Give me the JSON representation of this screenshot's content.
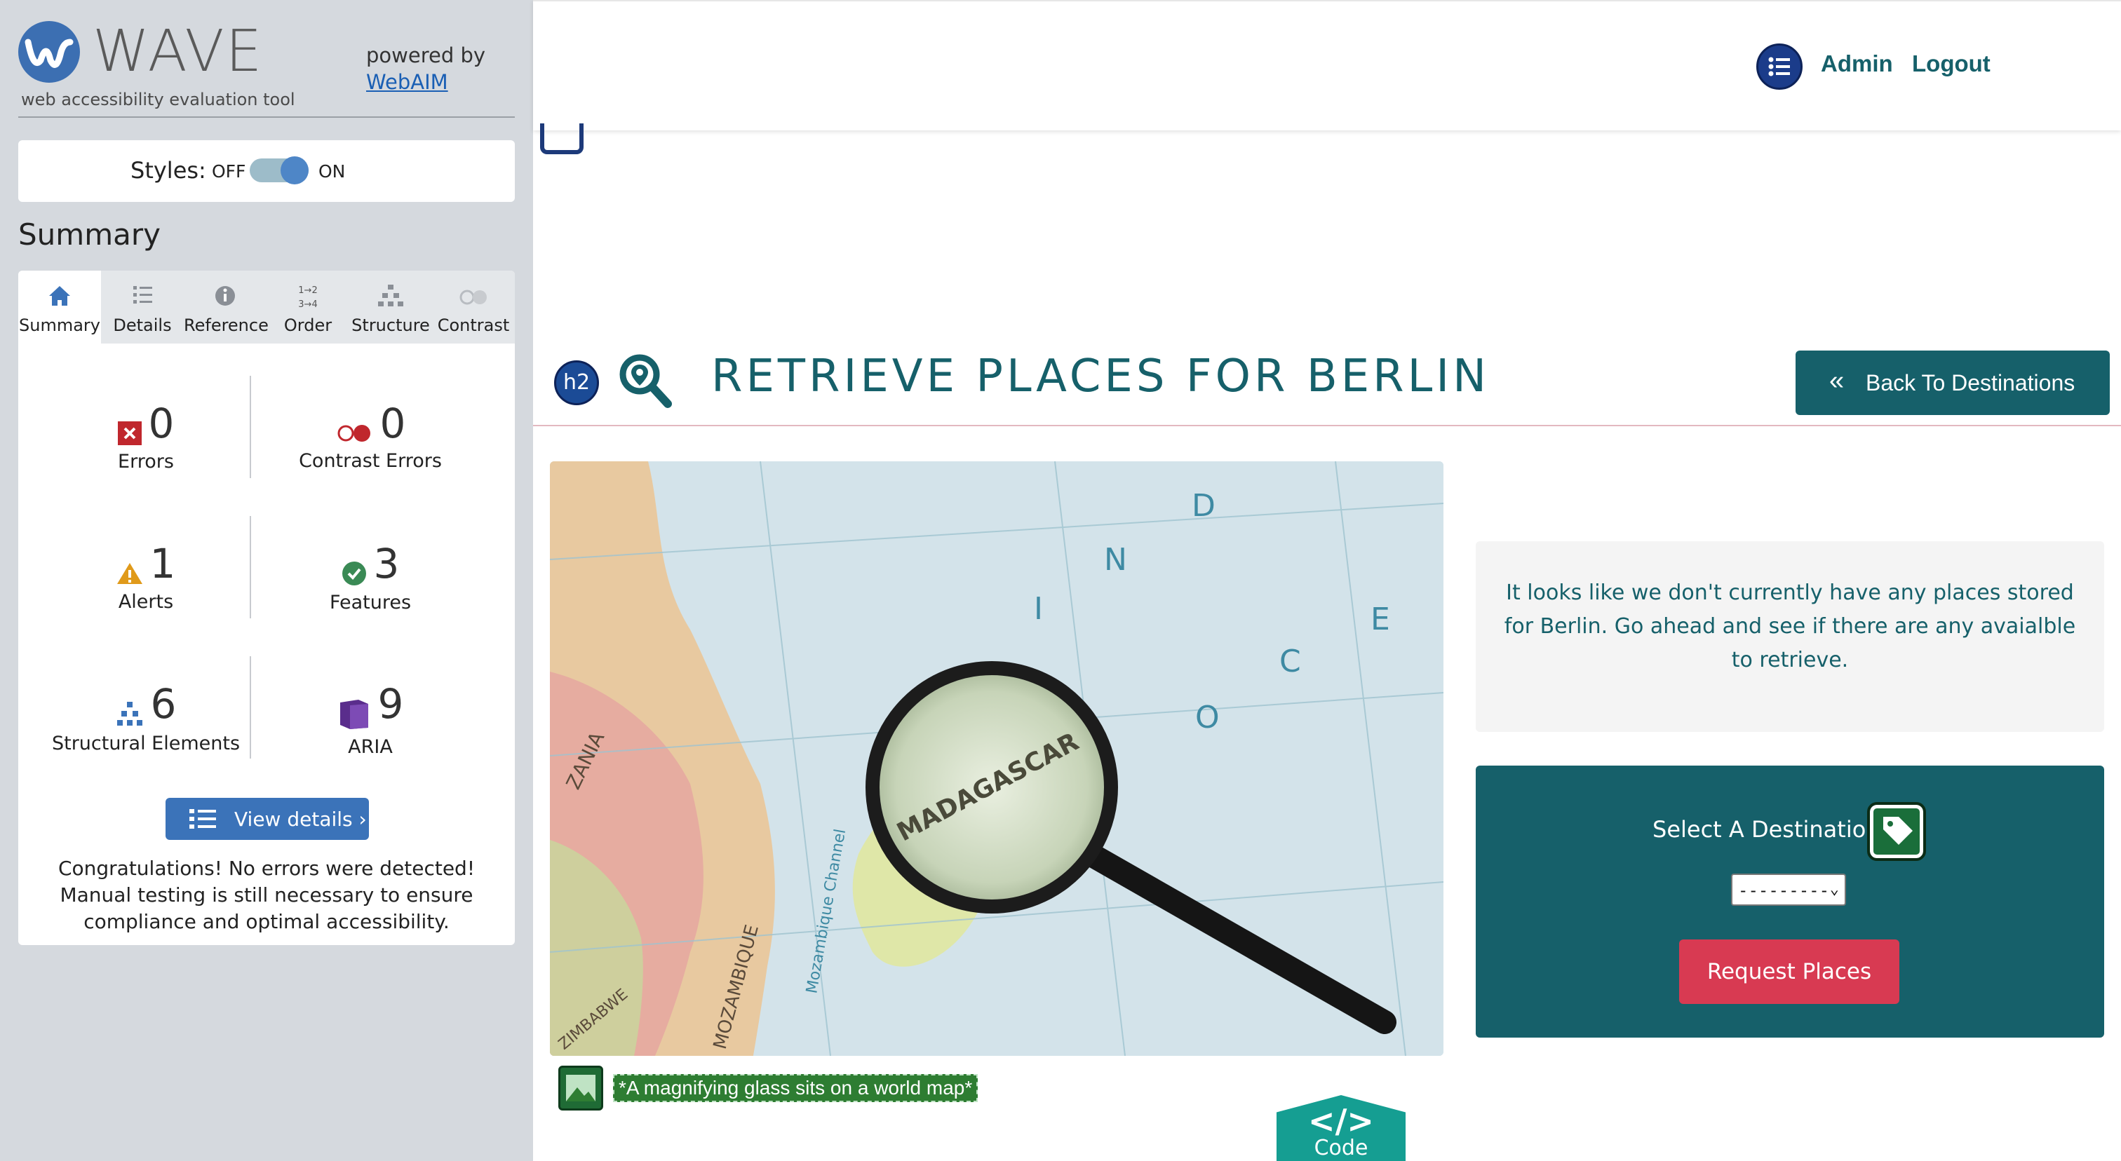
{
  "wave": {
    "title": "WAVE",
    "tagline": "web accessibility evaluation tool",
    "powered_by": "powered by",
    "webaim_link": "WebAIM",
    "styles_label": "Styles:",
    "styles_off": "OFF",
    "styles_on": "ON",
    "summary_heading": "Summary",
    "tabs": [
      {
        "label": "Summary",
        "icon": "home-icon"
      },
      {
        "label": "Details",
        "icon": "list-icon"
      },
      {
        "label": "Reference",
        "icon": "info-icon"
      },
      {
        "label": "Order",
        "icon": "order-icon"
      },
      {
        "label": "Structure",
        "icon": "structure-icon"
      },
      {
        "label": "Contrast",
        "icon": "contrast-icon"
      }
    ],
    "active_tab": "Summary",
    "stats": {
      "errors": {
        "count": "0",
        "label": "Errors"
      },
      "contrast_errors": {
        "count": "0",
        "label": "Contrast Errors"
      },
      "alerts": {
        "count": "1",
        "label": "Alerts"
      },
      "features": {
        "count": "3",
        "label": "Features"
      },
      "structural": {
        "count": "6",
        "label": "Structural Elements"
      },
      "aria": {
        "count": "9",
        "label": "ARIA"
      }
    },
    "view_details": "View details ›",
    "congrats": "Congratulations! No errors were detected! Manual testing is still necessary to ensure compliance and optimal accessibility.",
    "colors": {
      "accent": "#3b73b9",
      "error": "#c0272d",
      "alert": "#e09a1a",
      "feature": "#3a8a55",
      "aria": "#5a2d8c"
    }
  },
  "site": {
    "nav": {
      "admin": "Admin",
      "logout": "Logout"
    },
    "heading_badge": "h2",
    "page_title": "RETRIEVE PLACES FOR BERLIN",
    "back_button": "Back To Destinations",
    "back_button_icon": "«",
    "info_message": "It looks like we don't currently have any places stored for Berlin. Go ahead and see if there are any avaialble to retrieve.",
    "select_label": "Select A Destination",
    "select_value": "---------",
    "request_button": "Request Places",
    "image_alt": "*A magnifying glass sits on a world map*",
    "code_tab": {
      "glyph": "</>",
      "label": "Code"
    },
    "map_labels": [
      "I",
      "N",
      "D",
      "O",
      "C",
      "E",
      "MADAGASCAR",
      "Mozambique Channel",
      "ZANIA",
      "MOZAMBIQUE",
      "ZIMBABWE"
    ],
    "colors": {
      "primary": "#16606a",
      "danger": "#d83a52",
      "info_bg": "#f4f4f4"
    }
  }
}
